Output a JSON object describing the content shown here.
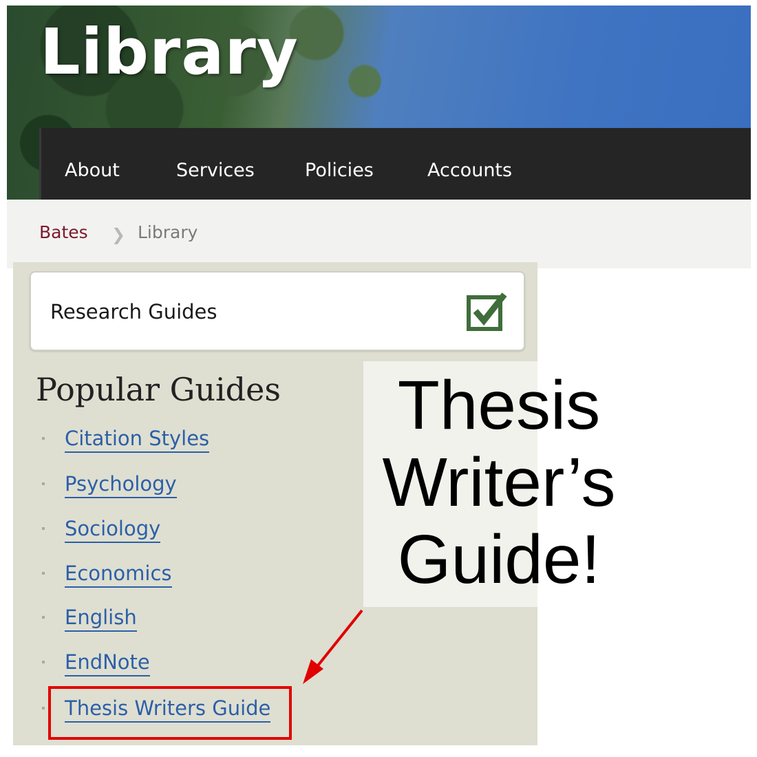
{
  "banner": {
    "title": "Library"
  },
  "nav": {
    "items": [
      {
        "label": "About"
      },
      {
        "label": "Services"
      },
      {
        "label": "Policies"
      },
      {
        "label": "Accounts"
      }
    ]
  },
  "breadcrumb": {
    "home": "Bates",
    "separator": "❯",
    "current": "Library"
  },
  "sidebar": {
    "research_guides": {
      "label": "Research Guides",
      "icon": "checkbox-checked-icon",
      "icon_color": "#3f6e3c"
    },
    "popular_title": "Popular Guides",
    "guides": [
      {
        "label": "Citation Styles"
      },
      {
        "label": "Psychology"
      },
      {
        "label": "Sociology"
      },
      {
        "label": "Economics"
      },
      {
        "label": "English"
      },
      {
        "label": "EndNote"
      },
      {
        "label": "Thesis Writers Guide"
      }
    ]
  },
  "annotation": {
    "lines": [
      "Thesis",
      "Writer’s",
      "Guide!"
    ],
    "highlight_color": "#e00000"
  },
  "colors": {
    "nav_bg": "#252525",
    "link": "#2c5fa8",
    "crumb_home": "#7c1a2a",
    "sidebar_bg": "#dedfd1"
  }
}
